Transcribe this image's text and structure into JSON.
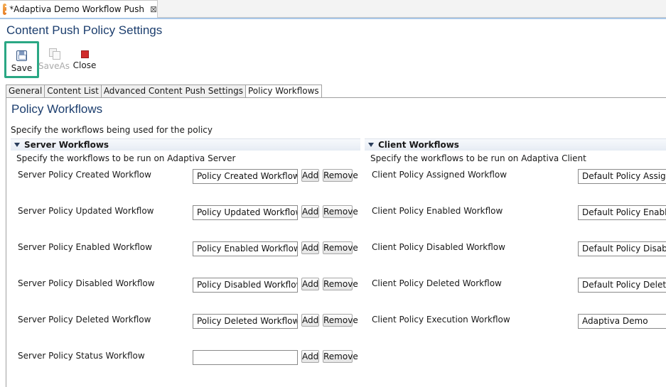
{
  "editor_tab": {
    "title": "*Adaptiva Demo Workflow Push",
    "close_glyph": "⊠",
    "icon": "rss-feed-icon"
  },
  "page": {
    "title": "Content Push Policy Settings"
  },
  "toolbar": {
    "save_label": "Save",
    "saveas_label": "SaveAs",
    "close_label": "Close"
  },
  "tabs": [
    "General",
    "Content List",
    "Advanced Content Push Settings",
    "Policy Workflows"
  ],
  "active_tab": "Policy Workflows",
  "section": {
    "title": "Policy Workflows",
    "description": "Specify the workflows being used for the policy"
  },
  "server": {
    "title": "Server Workflows",
    "description": "Specify the workflows to be run on Adaptiva Server",
    "add_label": "Add",
    "remove_label": "Remove",
    "rows": [
      {
        "label": "Server Policy Created Workflow",
        "value": "Policy Created Workflow"
      },
      {
        "label": "Server Policy Updated Workflow",
        "value": "Policy Updated Workflow"
      },
      {
        "label": "Server Policy Enabled Workflow",
        "value": "Policy Enabled Workflow"
      },
      {
        "label": "Server Policy Disabled Workflow",
        "value": "Policy Disabled Workflow"
      },
      {
        "label": "Server Policy Deleted Workflow",
        "value": "Policy Deleted Workflow"
      },
      {
        "label": "Server Policy Status Workflow",
        "value": ""
      }
    ]
  },
  "client": {
    "title": "Client Workflows",
    "description": "Specify the workflows to be run on Adaptiva Client",
    "rows": [
      {
        "label": "Client Policy Assigned Workflow",
        "value": "Default Policy Assignm"
      },
      {
        "label": "Client Policy Enabled Workflow",
        "value": "Default Policy Enable C"
      },
      {
        "label": "Client Policy Disabled Workflow",
        "value": "Default Policy Disable"
      },
      {
        "label": "Client Policy Deleted Workflow",
        "value": "Default Policy Delete C"
      },
      {
        "label": "Client Policy Execution Workflow",
        "value": "Adaptiva Demo"
      }
    ]
  },
  "colors": {
    "title_blue": "#1c3e6e",
    "highlight_green": "#2aa784",
    "close_red": "#d12b2b"
  }
}
